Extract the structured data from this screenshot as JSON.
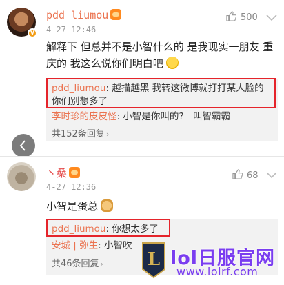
{
  "comments": [
    {
      "username": "pdd_liumou",
      "date": "4-27 12:46",
      "likes": "500",
      "text": "解释下 但总并不是小智什么的 是我现实一朋友 重庆的 我这么说你们明白吧",
      "replies": [
        {
          "author": "pdd_liumou",
          "text_line1": "越描越黑 我转这微博就打打某人脸的",
          "text_line2": "你们别想多了"
        },
        {
          "author": "李时珍的皮皮怪",
          "text": "小智是你叫的?　叫智霸霸"
        }
      ],
      "more_replies": "共152条回复"
    },
    {
      "username": "丶桑",
      "date": "4-27 12:36",
      "likes": "68",
      "text": "小智是蛋总",
      "replies": [
        {
          "author": "pdd_liumou",
          "text": "你想太多了"
        },
        {
          "author": "安城 | 弥生",
          "text": "小智吹"
        }
      ],
      "more_replies": "共46条回复"
    }
  ],
  "watermark": {
    "title": "lol日服官网",
    "url": "www.lolrf.com",
    "logo_letter": "L"
  },
  "colors": {
    "accent": "#eb7350",
    "highlight_box": "#e5242b",
    "watermark": "#7a3df0"
  },
  "icons": [
    "thumbs-up-icon",
    "chevron-down-icon",
    "back-arrow-icon",
    "verified-badge-icon",
    "level-badge-icon"
  ]
}
